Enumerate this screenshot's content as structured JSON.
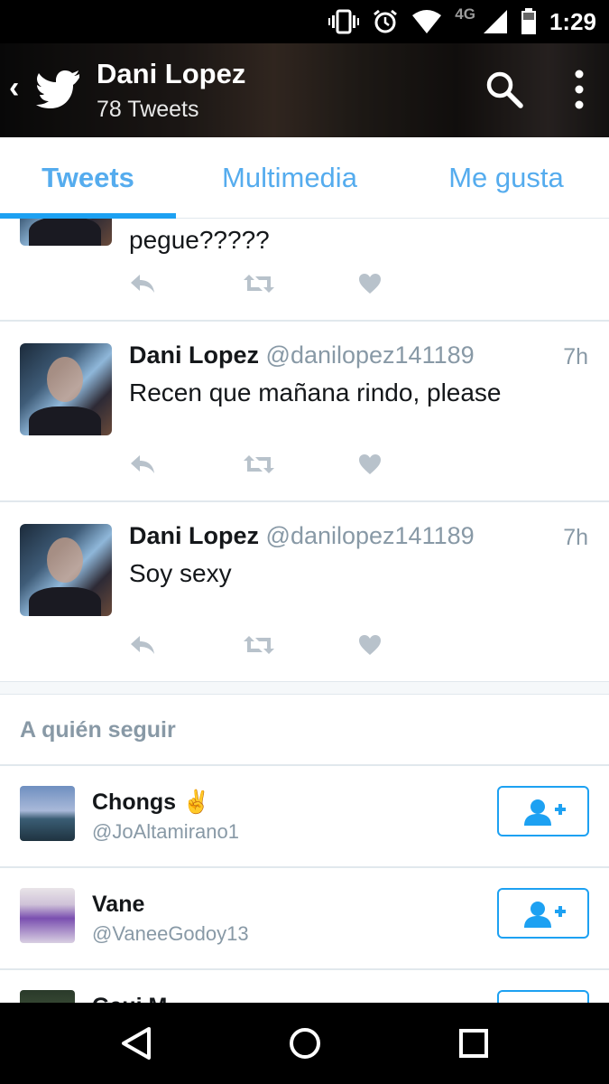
{
  "status_bar": {
    "network": "4G",
    "time": "1:29"
  },
  "header": {
    "name": "Dani Lopez",
    "subtitle": "78 Tweets"
  },
  "tabs": [
    {
      "label": "Tweets",
      "active": true
    },
    {
      "label": "Multimedia",
      "active": false
    },
    {
      "label": "Me gusta",
      "active": false
    }
  ],
  "tweets": [
    {
      "name": "",
      "handle": "",
      "time": "",
      "text": "pegue?????"
    },
    {
      "name": "Dani Lopez",
      "handle": "@danilopez141189",
      "time": "7h",
      "text": "Recen que mañana rindo, please"
    },
    {
      "name": "Dani Lopez",
      "handle": "@danilopez141189",
      "time": "7h",
      "text": "Soy sexy"
    }
  ],
  "who_to_follow": {
    "title": "A quién seguir",
    "users": [
      {
        "name": "Chongs ✌",
        "handle": "@JoAltamirano1"
      },
      {
        "name": "Vane",
        "handle": "@VaneeGodoy13"
      },
      {
        "name": "Gaui M",
        "handle": ""
      }
    ]
  },
  "colors": {
    "accent": "#1da1f2",
    "tab_text": "#55acee",
    "muted": "#8899a6",
    "action_icon": "#b8c2cb"
  },
  "icons": [
    "vibrate-icon",
    "alarm-icon",
    "wifi-icon",
    "signal-icon",
    "battery-icon",
    "back-icon",
    "twitter-bird-icon",
    "search-icon",
    "more-vertical-icon",
    "reply-icon",
    "retweet-icon",
    "like-icon",
    "follow-icon",
    "nav-back-icon",
    "nav-home-icon",
    "nav-recents-icon"
  ]
}
